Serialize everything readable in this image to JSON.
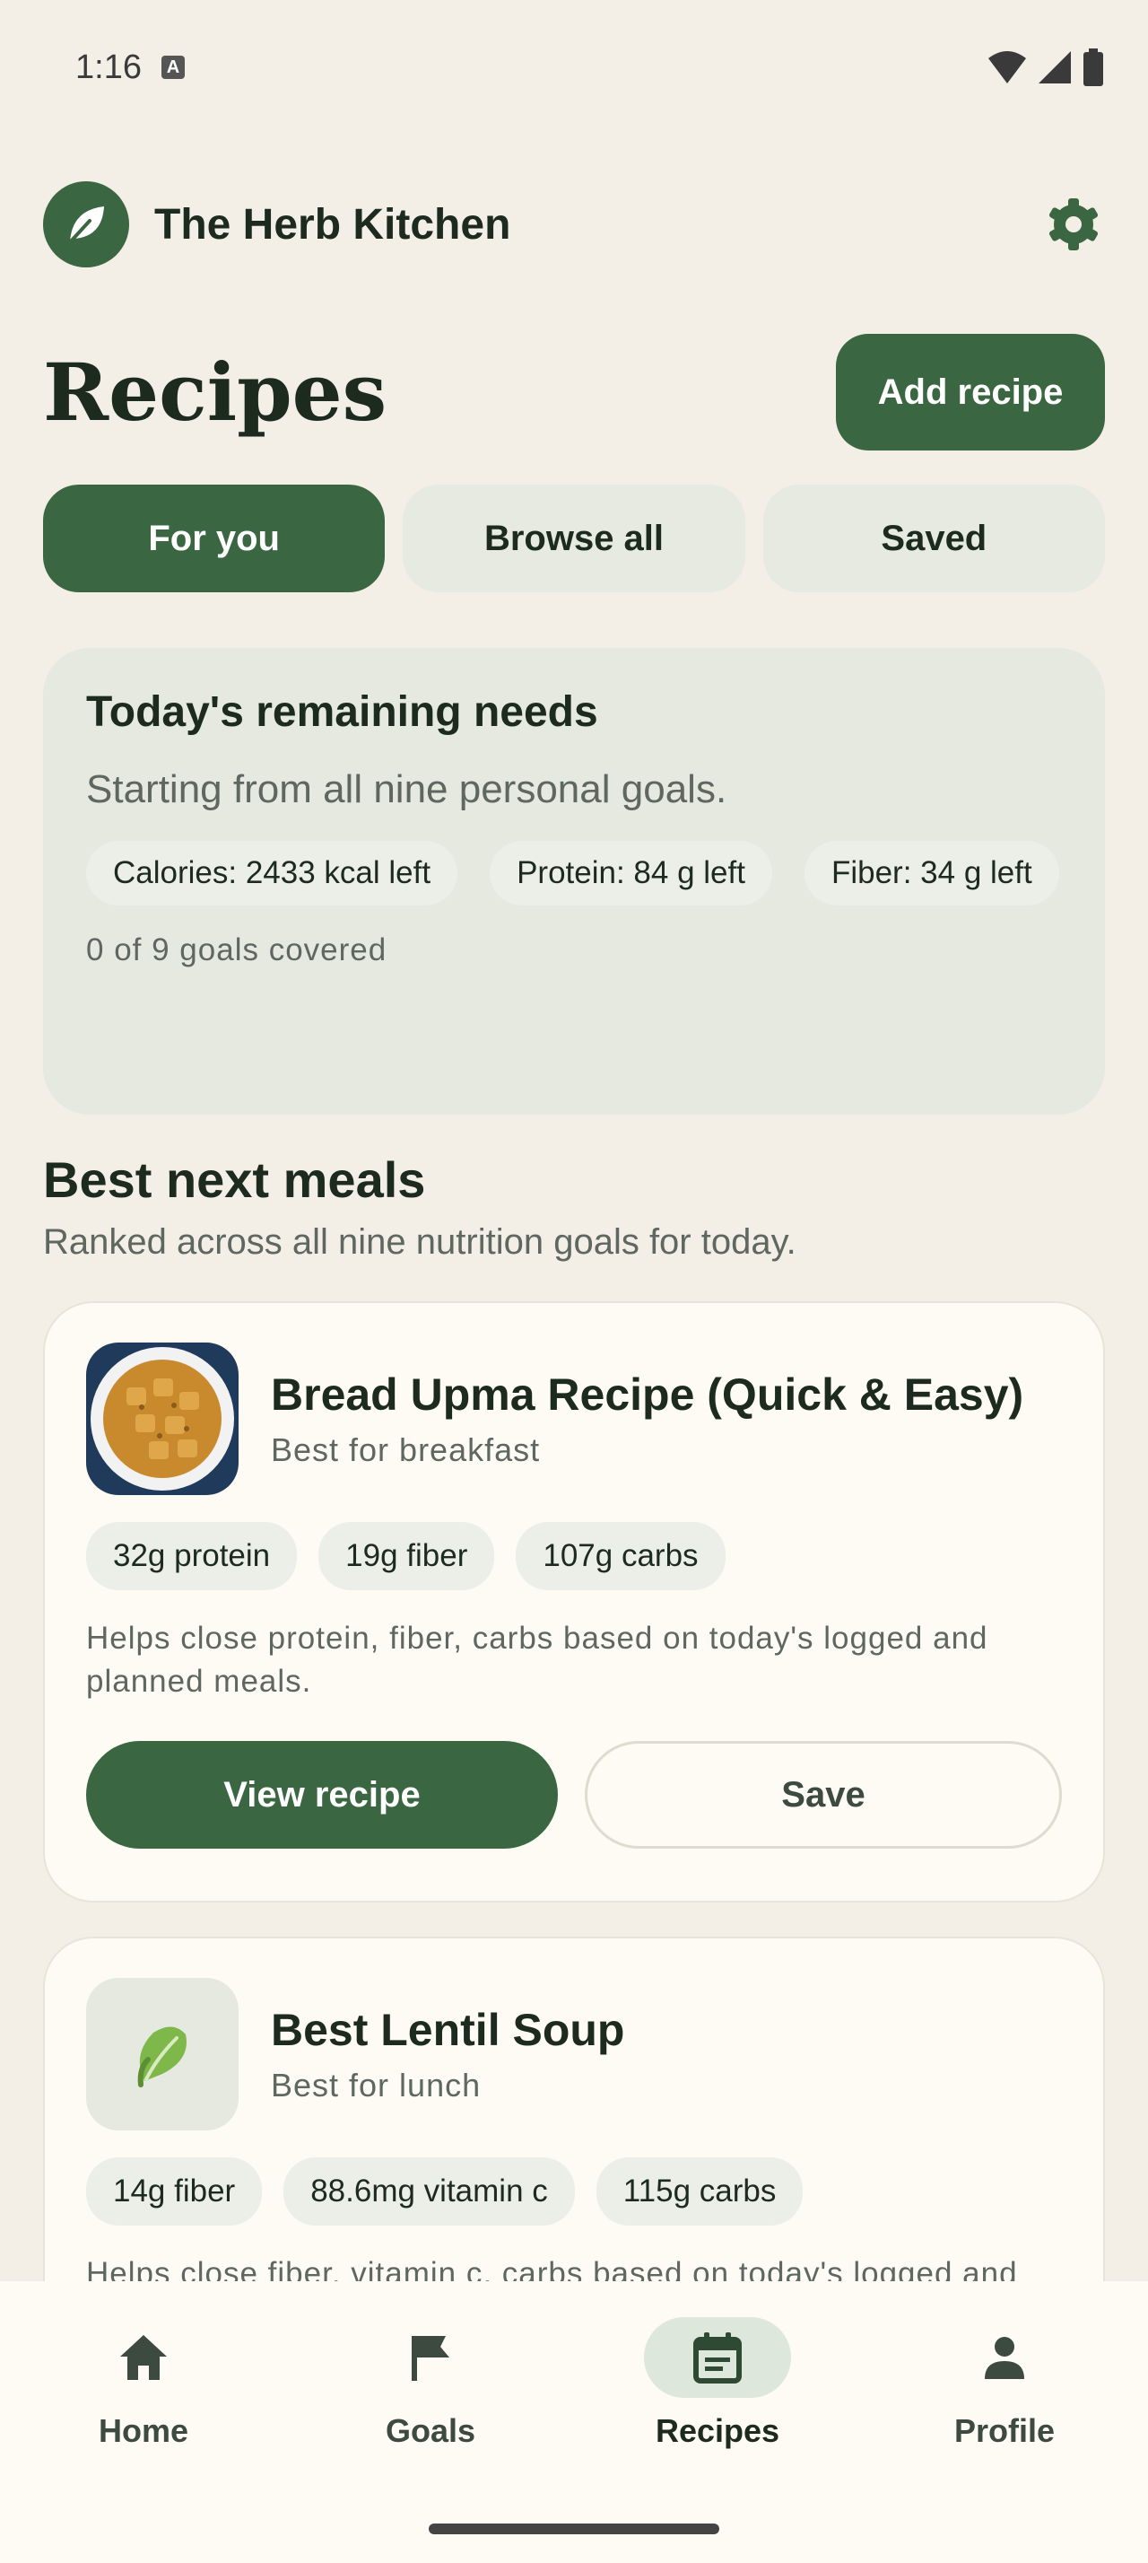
{
  "status_bar": {
    "time": "1:16",
    "badge": "A"
  },
  "app": {
    "name": "The Herb Kitchen"
  },
  "page": {
    "title": "Recipes",
    "add_button": "Add recipe"
  },
  "tabs": [
    {
      "label": "For you",
      "active": true
    },
    {
      "label": "Browse all",
      "active": false
    },
    {
      "label": "Saved",
      "active": false
    }
  ],
  "needs": {
    "title": "Today's remaining needs",
    "subtitle": "Starting from all nine personal goals.",
    "chips": [
      "Calories: 2433 kcal left",
      "Protein: 84 g left",
      "Fiber: 34 g left"
    ],
    "coverage": "0 of 9 goals covered"
  },
  "best_meals": {
    "title": "Best next meals",
    "subtitle": "Ranked across all nine nutrition goals for today.",
    "items": [
      {
        "name": "Bread Upma Recipe (Quick & Easy)",
        "when": "Best for breakfast",
        "chips": [
          "32g protein",
          "19g fiber",
          "107g carbs"
        ],
        "description": "Helps close protein, fiber, carbs based on today's logged and planned meals.",
        "view_label": "View recipe",
        "save_label": "Save"
      },
      {
        "name": "Best Lentil Soup",
        "when": "Best for lunch",
        "chips": [
          "14g fiber",
          "88.6mg vitamin c",
          "115g carbs"
        ],
        "description": "Helps close fiber, vitamin c, carbs based on today's logged and planned meals."
      }
    ]
  },
  "nav": [
    {
      "label": "Home",
      "icon": "home-icon",
      "active": false
    },
    {
      "label": "Goals",
      "icon": "flag-icon",
      "active": false
    },
    {
      "label": "Recipes",
      "icon": "calendar-icon",
      "active": true
    },
    {
      "label": "Profile",
      "icon": "person-icon",
      "active": false
    }
  ],
  "colors": {
    "primary": "#3a6741",
    "background": "#f3efe6",
    "card": "#fdfbf3",
    "tonal": "#e5e9df"
  }
}
